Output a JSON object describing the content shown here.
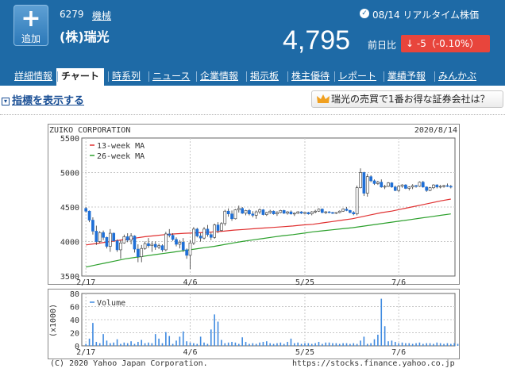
{
  "header": {
    "add_label": "追加",
    "code": "6279",
    "industry": "機械",
    "company": "(株)瑞光",
    "realtime": "08/14 リアルタイム株価",
    "price": "4,795",
    "change_label": "前日比",
    "change": "-5（-0.10%）",
    "colors": {
      "header_bg": "#1e6aa6",
      "down": "#e8453c"
    }
  },
  "tabs": [
    "詳細情報",
    "チャート",
    "時系列",
    "ニュース",
    "企業情報",
    "掲示板",
    "株主優待",
    "レポート",
    "業績予報",
    "みんかぶ"
  ],
  "active_tab": "チャート",
  "toolbar": {
    "indicator_link": "指標を表示する",
    "broker_button": "瑞光の売買で1番お得な証券会社は？"
  },
  "chart_data": {
    "type": "candlestick",
    "title_left": "ZUIKO CORPORATION",
    "date": "2020/8/14",
    "legend": [
      "13-week MA",
      "26-week MA"
    ],
    "volume_legend": "Volume",
    "volume_unit": "(x1000)",
    "x_ticks": [
      "2/17",
      "4/6",
      "5/25",
      "7/6"
    ],
    "y_ticks": [
      "5500",
      "5000",
      "4500",
      "4000",
      "3500"
    ],
    "ylim": [
      3500,
      5500
    ],
    "vol_ticks": [
      "80",
      "60",
      "40",
      "20",
      "0"
    ],
    "vol_ylim": [
      0,
      80
    ],
    "colors": {
      "up": "#ffffff",
      "down": "#1f6fd6",
      "ma13": "#e03030",
      "ma26": "#2ca02c",
      "volume": "#3f8ae0"
    },
    "candles": [
      [
        4480,
        4500,
        4420,
        4440
      ],
      [
        4440,
        4450,
        4280,
        4310
      ],
      [
        4310,
        4350,
        4100,
        4150
      ],
      [
        4150,
        4230,
        3950,
        4000
      ],
      [
        4000,
        4150,
        3980,
        4130
      ],
      [
        4130,
        4160,
        4020,
        4060
      ],
      [
        4060,
        4070,
        3900,
        3930
      ],
      [
        3930,
        4180,
        3850,
        4120
      ],
      [
        4120,
        4130,
        4000,
        4010
      ],
      [
        4010,
        4030,
        3850,
        3880
      ],
      [
        3880,
        4020,
        3750,
        3980
      ],
      [
        3980,
        4100,
        3970,
        4070
      ],
      [
        4070,
        4120,
        3990,
        4020
      ],
      [
        4020,
        4120,
        3960,
        4080
      ],
      [
        4080,
        4090,
        3840,
        3890
      ],
      [
        3890,
        3960,
        3700,
        3780
      ],
      [
        3780,
        3950,
        3700,
        3900
      ],
      [
        3900,
        4000,
        3880,
        3970
      ],
      [
        3970,
        4050,
        3910,
        3940
      ],
      [
        3940,
        4000,
        3850,
        3960
      ],
      [
        3960,
        4000,
        3880,
        3920
      ],
      [
        3920,
        3970,
        3890,
        3940
      ],
      [
        3940,
        3960,
        3850,
        3880
      ],
      [
        3880,
        4140,
        3860,
        4110
      ],
      [
        4110,
        4180,
        4060,
        4090
      ],
      [
        4090,
        4120,
        4010,
        4030
      ],
      [
        4030,
        4060,
        3930,
        3960
      ],
      [
        3960,
        4020,
        3900,
        3990
      ],
      [
        3990,
        4050,
        3850,
        3880
      ],
      [
        3880,
        3900,
        3750,
        3800
      ],
      [
        3800,
        4020,
        3600,
        3980
      ],
      [
        3980,
        4210,
        3950,
        4180
      ],
      [
        4180,
        4200,
        4060,
        4080
      ],
      [
        4080,
        4120,
        4000,
        4050
      ],
      [
        4050,
        4210,
        4030,
        4180
      ],
      [
        4180,
        4240,
        4070,
        4100
      ],
      [
        4100,
        4130,
        4020,
        4060
      ],
      [
        4060,
        4260,
        4040,
        4240
      ],
      [
        4240,
        4280,
        4120,
        4160
      ],
      [
        4160,
        4280,
        4150,
        4260
      ],
      [
        4260,
        4460,
        4230,
        4440
      ],
      [
        4440,
        4480,
        4360,
        4400
      ],
      [
        4400,
        4450,
        4300,
        4330
      ],
      [
        4330,
        4470,
        4320,
        4460
      ],
      [
        4460,
        4520,
        4420,
        4480
      ],
      [
        4480,
        4500,
        4400,
        4410
      ],
      [
        4410,
        4460,
        4380,
        4450
      ],
      [
        4450,
        4470,
        4380,
        4400
      ],
      [
        4400,
        4440,
        4350,
        4380
      ],
      [
        4380,
        4450,
        4330,
        4430
      ],
      [
        4430,
        4480,
        4400,
        4460
      ],
      [
        4460,
        4470,
        4380,
        4390
      ],
      [
        4390,
        4430,
        4370,
        4420
      ],
      [
        4420,
        4460,
        4400,
        4440
      ],
      [
        4440,
        4450,
        4390,
        4400
      ],
      [
        4400,
        4440,
        4370,
        4420
      ],
      [
        4420,
        4460,
        4410,
        4450
      ],
      [
        4450,
        4460,
        4400,
        4410
      ],
      [
        4410,
        4440,
        4390,
        4430
      ],
      [
        4430,
        4450,
        4390,
        4400
      ],
      [
        4400,
        4420,
        4370,
        4410
      ],
      [
        4410,
        4440,
        4400,
        4430
      ],
      [
        4430,
        4440,
        4400,
        4410
      ],
      [
        4410,
        4420,
        4400,
        4420
      ],
      [
        4420,
        4430,
        4390,
        4400
      ],
      [
        4400,
        4440,
        4380,
        4430
      ],
      [
        4430,
        4460,
        4410,
        4440
      ],
      [
        4440,
        4480,
        4430,
        4470
      ],
      [
        4470,
        4480,
        4410,
        4420
      ],
      [
        4420,
        4440,
        4400,
        4430
      ],
      [
        4430,
        4440,
        4410,
        4420
      ],
      [
        4420,
        4430,
        4400,
        4410
      ],
      [
        4410,
        4420,
        4400,
        4420
      ],
      [
        4420,
        4450,
        4410,
        4440
      ],
      [
        4440,
        4480,
        4430,
        4470
      ],
      [
        4470,
        4500,
        4440,
        4450
      ],
      [
        4450,
        4460,
        4410,
        4420
      ],
      [
        4420,
        4440,
        4380,
        4400
      ],
      [
        4400,
        4810,
        4380,
        4780
      ],
      [
        4780,
        5060,
        4770,
        5000
      ],
      [
        5000,
        5010,
        4660,
        4700
      ],
      [
        4700,
        4980,
        4650,
        4940
      ],
      [
        4940,
        4960,
        4860,
        4880
      ],
      [
        4880,
        4900,
        4820,
        4840
      ],
      [
        4840,
        4880,
        4820,
        4860
      ],
      [
        4860,
        4900,
        4780,
        4790
      ],
      [
        4790,
        4820,
        4760,
        4800
      ],
      [
        4800,
        4860,
        4790,
        4850
      ],
      [
        4850,
        4860,
        4780,
        4790
      ],
      [
        4790,
        4810,
        4730,
        4740
      ],
      [
        4740,
        4820,
        4720,
        4800
      ],
      [
        4800,
        4830,
        4780,
        4820
      ],
      [
        4820,
        4830,
        4760,
        4770
      ],
      [
        4770,
        4800,
        4740,
        4790
      ],
      [
        4790,
        4830,
        4760,
        4810
      ],
      [
        4810,
        4820,
        4780,
        4800
      ],
      [
        4800,
        4870,
        4790,
        4860
      ],
      [
        4860,
        4880,
        4780,
        4790
      ],
      [
        4790,
        4800,
        4720,
        4740
      ],
      [
        4740,
        4790,
        4730,
        4780
      ],
      [
        4780,
        4830,
        4760,
        4820
      ],
      [
        4820,
        4830,
        4770,
        4790
      ],
      [
        4790,
        4820,
        4770,
        4800
      ],
      [
        4800,
        4820,
        4780,
        4810
      ],
      [
        4810,
        4840,
        4790,
        4800
      ],
      [
        4800,
        4820,
        4770,
        4795
      ]
    ],
    "volumes": [
      3,
      11,
      35,
      6,
      4,
      18,
      8,
      4,
      5,
      10,
      3,
      5,
      4,
      7,
      3,
      6,
      9,
      4,
      5,
      4,
      18,
      11,
      4,
      21,
      15,
      3,
      8,
      14,
      22,
      7,
      5,
      4,
      3,
      14,
      5,
      3,
      25,
      48,
      37,
      9,
      4,
      5,
      6,
      5,
      3,
      13,
      6,
      3,
      4,
      3,
      5,
      6,
      7,
      4,
      3,
      4,
      5,
      3,
      6,
      11,
      4,
      5,
      3,
      4,
      4,
      3,
      4,
      6,
      3,
      5,
      5,
      4,
      4,
      3,
      4,
      4,
      3,
      4,
      3,
      8,
      14,
      3,
      4,
      10,
      17,
      72,
      30,
      7,
      8,
      6,
      4,
      5,
      4,
      4,
      3,
      4,
      5,
      3,
      4,
      4,
      3,
      5,
      4,
      3,
      4,
      3,
      4,
      3
    ],
    "ma13": [
      3950,
      3970,
      3990,
      4010,
      4030,
      4050,
      4070,
      4085,
      4100,
      4110,
      4120,
      4125,
      4130,
      4140,
      4150,
      4165,
      4175,
      4185,
      4195,
      4205,
      4215,
      4225,
      4240,
      4250,
      4270,
      4290,
      4310,
      4330,
      4360,
      4390,
      4420,
      4440,
      4470,
      4500,
      4530,
      4560,
      4590,
      4615
    ],
    "ma26": [
      3630,
      3660,
      3690,
      3720,
      3750,
      3770,
      3790,
      3810,
      3830,
      3850,
      3870,
      3890,
      3910,
      3930,
      3955,
      3980,
      4005,
      4025,
      4045,
      4065,
      4085,
      4100,
      4120,
      4140,
      4155,
      4170,
      4185,
      4200,
      4220,
      4240,
      4260,
      4280,
      4300,
      4320,
      4340,
      4360,
      4380,
      4400
    ]
  },
  "footer": {
    "copyright": "(C) 2020 Yahoo Japan Corporation.",
    "url": "https://stocks.finance.yahoo.co.jp"
  }
}
